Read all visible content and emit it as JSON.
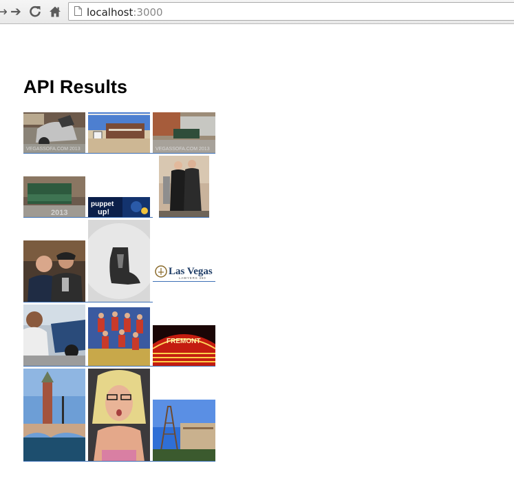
{
  "browser": {
    "url_host": "localhost",
    "url_port": ":3000",
    "icons": [
      "back-arrow-icon",
      "forward-arrow-icon",
      "reload-icon",
      "home-icon",
      "page-icon"
    ]
  },
  "page": {
    "heading": "API Results"
  },
  "results": {
    "count": 15,
    "items": [
      {
        "subject": "dismantled car in parking lot",
        "overlay_text": "VEGASSOFA.COM 2013"
      },
      {
        "subject": "desert motel building",
        "overlay_text": ""
      },
      {
        "subject": "couch by shed",
        "overlay_text": "VEGASSOFA.COM 2013"
      },
      {
        "subject": "green couch against wall",
        "overlay_text": "2013"
      },
      {
        "subject": "puppet show banner",
        "overlay_text": "puppet up!"
      },
      {
        "subject": "couple posing",
        "overlay_text": ""
      },
      {
        "subject": "two men at event",
        "overlay_text": ""
      },
      {
        "subject": "cowboy boot charm",
        "overlay_text": ""
      },
      {
        "subject": "Las Vegas Lawyers logo",
        "overlay_text": "Las Vegas",
        "overlay_subtext": "LAWYERS 360"
      },
      {
        "subject": "person after car accident",
        "overlay_text": ""
      },
      {
        "subject": "cheer team group photo",
        "overlay_text": ""
      },
      {
        "subject": "Fremont neon casino sign",
        "overlay_text": "FREMONT"
      },
      {
        "subject": "Venetian bell tower and bridge",
        "overlay_text": ""
      },
      {
        "subject": "blonde woman portrait",
        "overlay_text": ""
      },
      {
        "subject": "Paris Las Vegas Eiffel tower",
        "overlay_text": ""
      }
    ]
  }
}
